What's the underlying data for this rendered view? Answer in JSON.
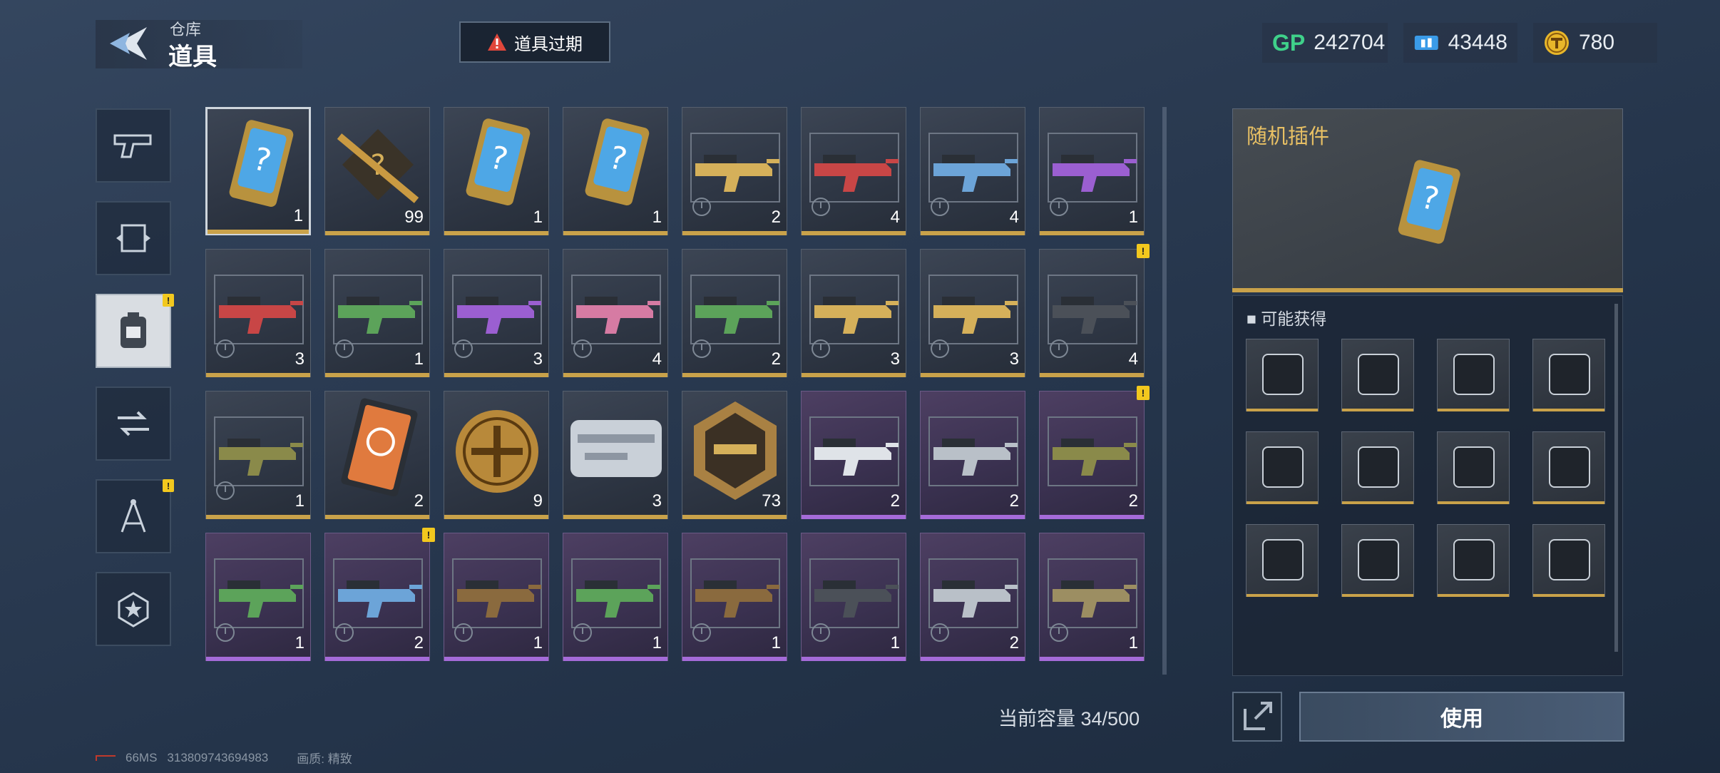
{
  "header": {
    "breadcrumb_small": "仓库",
    "title": "道具",
    "expire_button": "道具过期",
    "currencies": [
      {
        "name": "gp-icon",
        "label": "GP",
        "value": "242704",
        "color": "#3fd18a"
      },
      {
        "name": "ticket-icon",
        "value": "43448",
        "color": "#3a9be8"
      },
      {
        "name": "coin-icon",
        "value": "780",
        "color": "#e8b72a"
      }
    ]
  },
  "tabs": [
    {
      "name": "tab-weapons",
      "icon": "pistol-icon"
    },
    {
      "name": "tab-skins",
      "icon": "frame-icon"
    },
    {
      "name": "tab-items",
      "icon": "pack-icon",
      "active": true,
      "alert": "!"
    },
    {
      "name": "tab-exchange",
      "icon": "exchange-icon"
    },
    {
      "name": "tab-blueprints",
      "icon": "compass-icon",
      "alert": "!"
    },
    {
      "name": "tab-rewards",
      "icon": "star-badge-icon"
    }
  ],
  "items": [
    {
      "icon": "random-plugin-card-icon",
      "count": "1",
      "rarity": "gold",
      "selected": true
    },
    {
      "icon": "blueprint-box-icon",
      "count": "99",
      "rarity": "gold"
    },
    {
      "icon": "random-plugin-card-icon",
      "count": "1",
      "rarity": "gold"
    },
    {
      "icon": "random-plugin-card-icon",
      "count": "1",
      "rarity": "gold"
    },
    {
      "icon": "rifle-gold-icon",
      "count": "2",
      "rarity": "gold",
      "timed": true
    },
    {
      "icon": "rifle-red-icon",
      "count": "4",
      "rarity": "gold",
      "timed": true
    },
    {
      "icon": "smg-blue-icon",
      "count": "4",
      "rarity": "gold",
      "timed": true
    },
    {
      "icon": "rifle-purple-icon",
      "count": "1",
      "rarity": "gold",
      "timed": true
    },
    {
      "icon": "rifle-red-icon",
      "count": "3",
      "rarity": "gold",
      "timed": true
    },
    {
      "icon": "lmg-green-icon",
      "count": "1",
      "rarity": "gold",
      "timed": true
    },
    {
      "icon": "sniper-purple-icon",
      "count": "3",
      "rarity": "gold",
      "timed": true
    },
    {
      "icon": "shotgun-pink-icon",
      "count": "4",
      "rarity": "gold",
      "timed": true
    },
    {
      "icon": "smg-green-icon",
      "count": "2",
      "rarity": "gold",
      "timed": true
    },
    {
      "icon": "pistol-gold-icon",
      "count": "3",
      "rarity": "gold",
      "timed": true
    },
    {
      "icon": "sniper-gold-icon",
      "count": "3",
      "rarity": "gold",
      "timed": true
    },
    {
      "icon": "rifle-dark-icon",
      "count": "4",
      "rarity": "gold",
      "timed": true,
      "alert": "!"
    },
    {
      "icon": "pistol-camo-icon",
      "count": "1",
      "rarity": "gold",
      "timed": true
    },
    {
      "icon": "orange-card-icon",
      "count": "2",
      "rarity": "gold"
    },
    {
      "icon": "gold-medal-icon",
      "count": "9",
      "rarity": "gold"
    },
    {
      "icon": "silver-case-icon",
      "count": "3",
      "rarity": "gold"
    },
    {
      "icon": "hex-weapon-badge-icon",
      "count": "73",
      "rarity": "gold"
    },
    {
      "icon": "smg-white-icon",
      "count": "2",
      "rarity": "purple"
    },
    {
      "icon": "shotgun-silver-icon",
      "count": "2",
      "rarity": "purple"
    },
    {
      "icon": "rifle-camo-icon",
      "count": "2",
      "rarity": "purple",
      "alert": "!"
    },
    {
      "icon": "launcher-green-icon",
      "count": "1",
      "rarity": "purple",
      "timed": true
    },
    {
      "icon": "crossbow-blue-icon",
      "count": "2",
      "rarity": "purple",
      "timed": true,
      "alert": "!"
    },
    {
      "icon": "rifle-brown-icon",
      "count": "1",
      "rarity": "purple",
      "timed": true
    },
    {
      "icon": "rifle-green-icon",
      "count": "1",
      "rarity": "purple",
      "timed": true
    },
    {
      "icon": "smg-brown-icon",
      "count": "1",
      "rarity": "purple",
      "timed": true
    },
    {
      "icon": "lmg-dark-icon",
      "count": "1",
      "rarity": "purple",
      "timed": true
    },
    {
      "icon": "pistol-silver-icon",
      "count": "2",
      "rarity": "purple",
      "timed": true
    },
    {
      "icon": "rifle-khaki-icon",
      "count": "1",
      "rarity": "purple",
      "timed": true
    }
  ],
  "capacity": "当前容量 34/500",
  "detail": {
    "title": "随机插件",
    "icon": "random-plugin-card-icon",
    "drops_title": "可能获得",
    "drops": [
      "plugin-burst-icon",
      "plugin-reload-icon",
      "plugin-ammo-icon",
      "plugin-scope-icon",
      "plugin-fire-icon",
      "plugin-target-icon",
      "plugin-bullet-icon",
      "plugin-grip-icon",
      "plugin-cross-icon",
      "plugin-mag-icon",
      "plugin-sight-icon",
      "plugin-muzzle-icon"
    ]
  },
  "actions": {
    "use_label": "使用",
    "share_icon": "share-icon"
  },
  "footer": {
    "ping": "66MS",
    "id": "313809743694983",
    "quality": "画质: 精致"
  }
}
